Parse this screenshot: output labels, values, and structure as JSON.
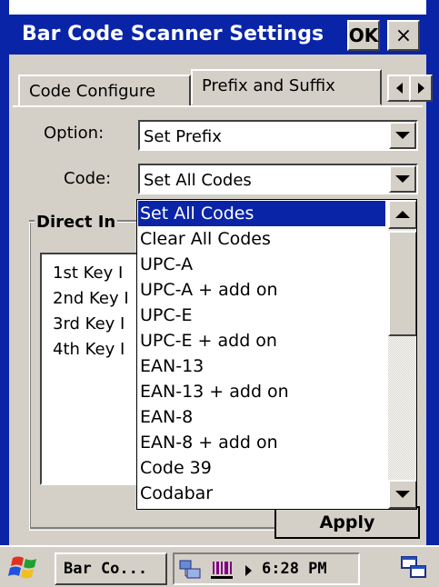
{
  "window": {
    "title": "Bar Code Scanner Settings",
    "ok_label": "OK",
    "close_label": "×"
  },
  "tabs": [
    {
      "label": "Code Configure",
      "active": false
    },
    {
      "label": "Prefix and Suffix",
      "active": true
    }
  ],
  "form": {
    "option_label": "Option:",
    "option_value": "Set Prefix",
    "code_label": "Code:",
    "code_value": "Set All Codes"
  },
  "group": {
    "title": "Direct In",
    "keys": [
      "1st  Key I",
      "2nd Key I",
      "3rd Key I",
      "4th Key I"
    ]
  },
  "apply_label": "Apply",
  "dropdown": {
    "items": [
      "Set All Codes",
      "Clear All Codes",
      "UPC-A",
      "UPC-A + add on",
      "UPC-E",
      "UPC-E + add on",
      "EAN-13",
      "EAN-13 + add on",
      "EAN-8",
      "EAN-8 + add on",
      "Code 39",
      "Codabar"
    ],
    "selected": "Set All Codes"
  },
  "taskbar": {
    "task_label": "Bar Co...",
    "clock": "6:28 PM"
  },
  "colors": {
    "title_bar": "#0a24a8",
    "selection": "#0a24a8",
    "face": "#d4d0c8"
  },
  "icons": {
    "start": "windows-flag-icon",
    "network": "network-icon",
    "barcode": "barcode-icon",
    "desktop": "desktop-icon"
  }
}
